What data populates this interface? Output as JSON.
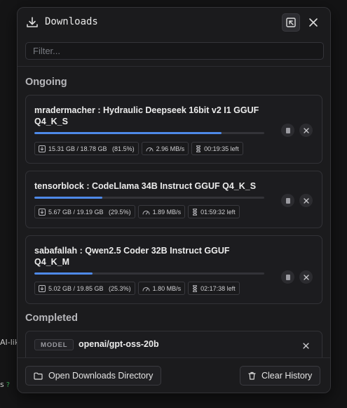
{
  "background": {
    "fragment_1": "AI-lik",
    "fragment_2": "s"
  },
  "header": {
    "title": "Downloads",
    "icons": [
      "download-icon",
      "expand-icon",
      "close-icon"
    ]
  },
  "filter": {
    "placeholder": "Filter...",
    "value": ""
  },
  "sections": {
    "ongoing_title": "Ongoing",
    "completed_title": "Completed"
  },
  "ongoing": [
    {
      "name": "mradermacher : Hydraulic Deepseek 16bit v2 I1 GGUF Q4_K_S",
      "size": "15.31 GB / 18.78 GB   (81.5%)",
      "progress": 0.815,
      "speed": "2.96 MB/s",
      "eta": "00:19:35 left"
    },
    {
      "name": "tensorblock : CodeLlama 34B Instruct GGUF Q4_K_S",
      "size": "5.67 GB / 19.19 GB   (29.5%)",
      "progress": 0.295,
      "speed": "1.89 MB/s",
      "eta": "01:59:32 left"
    },
    {
      "name": "sabafallah : Qwen2.5 Coder 32B Instruct GGUF Q4_K_M",
      "size": "5.02 GB / 19.85 GB   (25.3%)",
      "progress": 0.253,
      "speed": "1.80 MB/s",
      "eta": "02:17:38 left"
    }
  ],
  "completed": [
    {
      "badge": "MODEL",
      "name": "openai/gpt-oss-20b"
    }
  ],
  "footer": {
    "open_dir_label": "Open Downloads Directory",
    "clear_label": "Clear History"
  },
  "colors": {
    "accent": "#4e89e8",
    "panel": "#1b1b1d",
    "border": "#333337"
  }
}
